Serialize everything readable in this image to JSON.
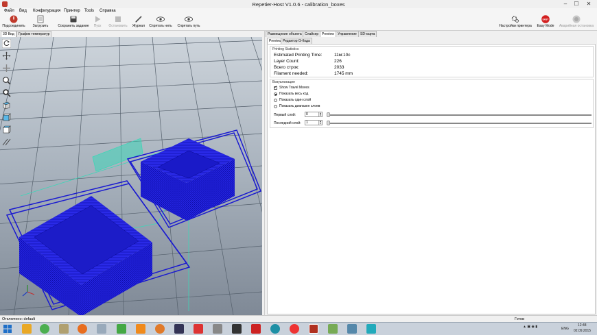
{
  "window": {
    "title": "Repetier-Host V1.0.6 - calibration_boxes",
    "controls": [
      "–",
      "☐",
      "✕"
    ]
  },
  "menu": [
    "Файл",
    "Вид",
    "Конфигурация",
    "Принтер",
    "Tools",
    "Справка"
  ],
  "toolbar": {
    "connect": "Подсоединить",
    "load": "Загрузить",
    "save_job": "Сохранить задание",
    "start": "Пуск",
    "stop": "Остановить",
    "log": "Журнал",
    "hide_thread": "Спрятать нить",
    "hide_path": "Спрятать путь",
    "printer_settings": "Настройки принтера",
    "easy_mode": "Easy Mode",
    "easy_badge": "EASY",
    "emergency": "Аварийная остановка"
  },
  "left_tabs": [
    "3D Вид",
    "График температур"
  ],
  "right_tabs": [
    "Размещение объекта",
    "Слайсер",
    "Preview",
    "Управление",
    "SD-карта"
  ],
  "sub_tabs": [
    "Preview",
    "Редактор G-Кода"
  ],
  "stats": {
    "group_title": "Printing Statistics",
    "rows": [
      {
        "label": "Estimated Printing Time:",
        "value": "11м:10с"
      },
      {
        "label": "Layer Count:",
        "value": "226"
      },
      {
        "label": "Всего строк:",
        "value": "2033"
      },
      {
        "label": "Filament needed:",
        "value": "1745 mm"
      }
    ]
  },
  "visual": {
    "group_title": "Визуализация",
    "show_travel": "Show Travel Moves",
    "show_all": "Показать весь код",
    "show_one": "Показать один слой",
    "show_range": "Показать диапазон слоев",
    "first_layer_label": "Первый слой:",
    "first_layer_value": "0",
    "last_layer_label": "Последний слой:",
    "last_layer_value": "1"
  },
  "status": {
    "left": "Отключено: default",
    "right": "Готов"
  },
  "taskbar": {
    "lang": "ENG",
    "time": "12:48",
    "date": "02.09.2015"
  },
  "colors": {
    "print": "#1f1fd8",
    "bed": "#7e8a98",
    "accent": "#3dd6b8"
  }
}
